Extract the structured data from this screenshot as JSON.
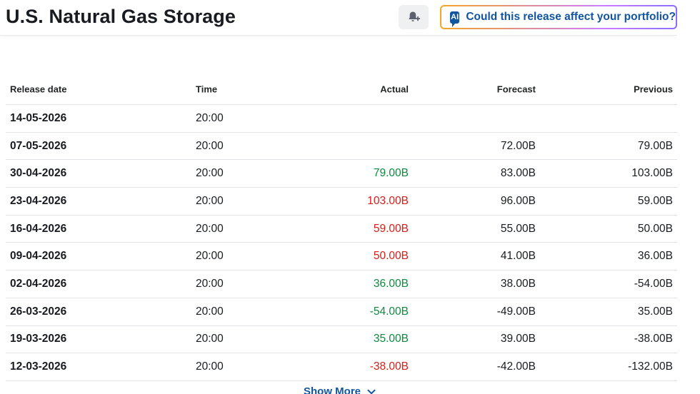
{
  "header": {
    "title": "U.S. Natural Gas Storage",
    "ai_badge": "AI",
    "ai_button_label": "Could this release affect your portfolio?"
  },
  "table": {
    "columns": {
      "release_date": "Release date",
      "time": "Time",
      "actual": "Actual",
      "forecast": "Forecast",
      "previous": "Previous"
    },
    "rows": [
      {
        "date": "14-05-2026",
        "time": "20:00",
        "actual": "",
        "actual_status": "",
        "forecast": "",
        "previous": ""
      },
      {
        "date": "07-05-2026",
        "time": "20:00",
        "actual": "",
        "actual_status": "",
        "forecast": "72.00B",
        "previous": "79.00B"
      },
      {
        "date": "30-04-2026",
        "time": "20:00",
        "actual": "79.00B",
        "actual_status": "pos",
        "forecast": "83.00B",
        "previous": "103.00B"
      },
      {
        "date": "23-04-2026",
        "time": "20:00",
        "actual": "103.00B",
        "actual_status": "neg",
        "forecast": "96.00B",
        "previous": "59.00B"
      },
      {
        "date": "16-04-2026",
        "time": "20:00",
        "actual": "59.00B",
        "actual_status": "neg",
        "forecast": "55.00B",
        "previous": "50.00B"
      },
      {
        "date": "09-04-2026",
        "time": "20:00",
        "actual": "50.00B",
        "actual_status": "neg",
        "forecast": "41.00B",
        "previous": "36.00B"
      },
      {
        "date": "02-04-2026",
        "time": "20:00",
        "actual": "36.00B",
        "actual_status": "pos",
        "forecast": "38.00B",
        "previous": "-54.00B"
      },
      {
        "date": "26-03-2026",
        "time": "20:00",
        "actual": "-54.00B",
        "actual_status": "pos",
        "forecast": "-49.00B",
        "previous": "35.00B"
      },
      {
        "date": "19-03-2026",
        "time": "20:00",
        "actual": "35.00B",
        "actual_status": "pos",
        "forecast": "39.00B",
        "previous": "-38.00B"
      },
      {
        "date": "12-03-2026",
        "time": "20:00",
        "actual": "-38.00B",
        "actual_status": "neg",
        "forecast": "-42.00B",
        "previous": "-132.00B"
      }
    ],
    "show_more_label": "Show More"
  },
  "colors": {
    "positive": "#0e8a3e",
    "negative": "#d91e18",
    "link": "#1256a0"
  },
  "icons": {
    "alert": "bell-plus-icon",
    "ai": "ai-badge-icon",
    "show_more": "chevron-down-icon"
  }
}
